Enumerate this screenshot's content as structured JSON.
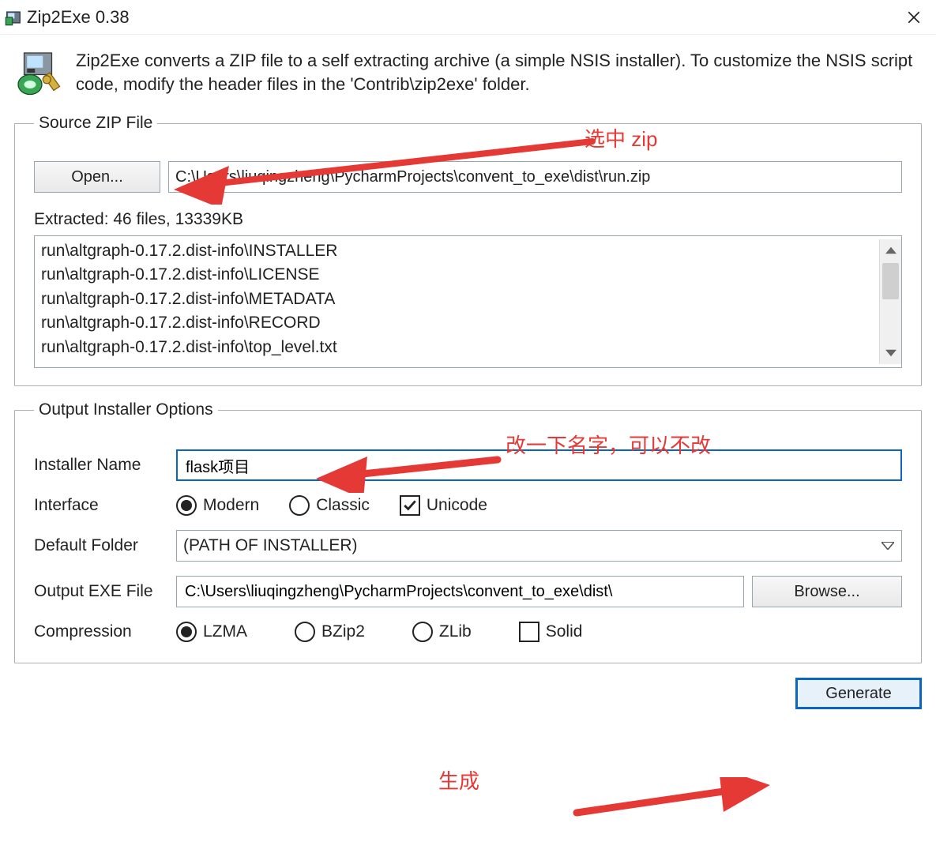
{
  "window": {
    "title": "Zip2Exe 0.38",
    "description": "Zip2Exe converts a ZIP file to a self extracting archive (a simple NSIS installer). To customize the NSIS script code, modify the header files in the 'Contrib\\zip2exe' folder."
  },
  "source_group": {
    "legend": "Source ZIP File",
    "open_label": "Open...",
    "zip_path": "C:\\Users\\liuqingzheng\\PycharmProjects\\convent_to_exe\\dist\\run.zip",
    "extracted_status": "Extracted: 46 files, 13339KB",
    "file_list": [
      "run\\altgraph-0.17.2.dist-info\\INSTALLER",
      "run\\altgraph-0.17.2.dist-info\\LICENSE",
      "run\\altgraph-0.17.2.dist-info\\METADATA",
      "run\\altgraph-0.17.2.dist-info\\RECORD",
      "run\\altgraph-0.17.2.dist-info\\top_level.txt"
    ]
  },
  "output_group": {
    "legend": "Output Installer Options",
    "labels": {
      "installer_name": "Installer Name",
      "interface": "Interface",
      "default_folder": "Default Folder",
      "output_exe": "Output EXE File",
      "compression": "Compression"
    },
    "installer_name_value": "flask项目",
    "interface_options": {
      "modern": "Modern",
      "classic": "Classic",
      "unicode": "Unicode"
    },
    "default_folder_value": "(PATH OF INSTALLER)",
    "output_exe_value": "C:\\Users\\liuqingzheng\\PycharmProjects\\convent_to_exe\\dist\\",
    "browse_label": "Browse...",
    "compression_options": {
      "lzma": "LZMA",
      "bzip2": "BZip2",
      "zlib": "ZLib",
      "solid": "Solid"
    }
  },
  "generate_label": "Generate",
  "annotations": {
    "a1": "选中 zip",
    "a2": "改一下名字，可以不改",
    "a3": "生成"
  }
}
